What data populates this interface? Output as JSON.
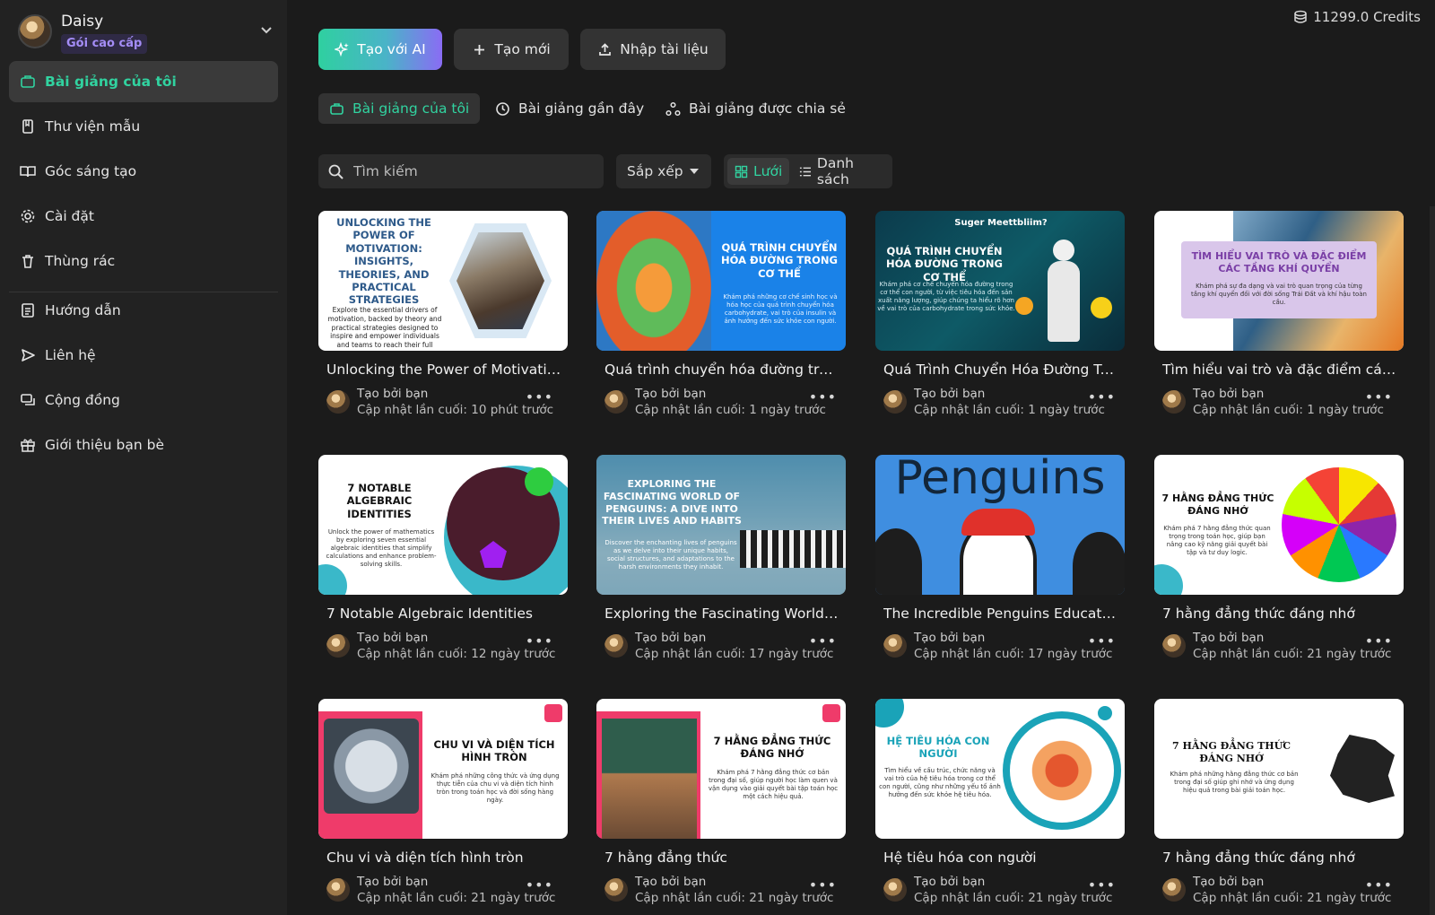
{
  "profile": {
    "name": "Daisy",
    "plan": "Gói cao cấp"
  },
  "credits": "11299.0 Credits",
  "sidebar": {
    "items": [
      {
        "label": "Bài giảng của tôi",
        "icon": "briefcase-icon"
      },
      {
        "label": "Thư viện mẫu",
        "icon": "book-icon"
      },
      {
        "label": "Góc sáng tạo",
        "icon": "open-book-icon"
      },
      {
        "label": "Cài đặt",
        "icon": "gear-icon"
      },
      {
        "label": "Thùng rác",
        "icon": "trash-icon"
      },
      {
        "label": "Hướng dẫn",
        "icon": "document-icon"
      },
      {
        "label": "Liên hệ",
        "icon": "send-icon"
      },
      {
        "label": "Cộng đồng",
        "icon": "community-icon"
      },
      {
        "label": "Giới thiệu bạn bè",
        "icon": "gift-icon"
      }
    ]
  },
  "actions": {
    "ai": "Tạo với AI",
    "new": "Tạo mới",
    "import": "Nhập tài liệu"
  },
  "tabs": [
    {
      "label": "Bài giảng của tôi"
    },
    {
      "label": "Bài giảng gần đây"
    },
    {
      "label": "Bài giảng được chia sẻ"
    }
  ],
  "search": {
    "placeholder": "Tìm kiếm"
  },
  "sort": {
    "label": "Sắp xếp"
  },
  "view": {
    "grid": "Lưới",
    "list": "Danh sách"
  },
  "cards": [
    {
      "title": "Unlocking the Power of Motivatio...",
      "creator": "Tạo bởi bạn",
      "updated": "Cập nhật lần cuối: 10 phút trước",
      "thumb": {
        "heading": "UNLOCKING THE POWER OF MOTIVATION: INSIGHTS, THEORIES, AND PRACTICAL STRATEGIES",
        "body": "Explore the essential drivers of motivation, backed by theory and practical strategies designed to inspire and empower individuals and teams to reach their full potential."
      }
    },
    {
      "title": "Quá trình chuyển hóa đường tron...",
      "creator": "Tạo bởi bạn",
      "updated": "Cập nhật lần cuối: 1 ngày trước",
      "thumb": {
        "heading": "QUÁ TRÌNH CHUYỂN HÓA ĐƯỜNG TRONG CƠ THỂ",
        "body": "Khám phá những cơ chế sinh học và hóa học của quá trình chuyển hóa carbohydrate, vai trò của insulin và ảnh hưởng đến sức khỏe con người."
      }
    },
    {
      "title": "Quá Trình Chuyển Hóa Đường Tro...",
      "creator": "Tạo bởi bạn",
      "updated": "Cập nhật lần cuối: 1 ngày trước",
      "thumb": {
        "top": "Suger Meettbliim?",
        "heading": "QUÁ TRÌNH CHUYỂN HÓA ĐƯỜNG TRONG CƠ THỂ",
        "body": "Khám phá cơ chế chuyển hóa đường trong cơ thể con người, từ việc tiêu hóa đến sản xuất năng lượng, giúp chúng ta hiểu rõ hơn về vai trò của carbohydrate trong sức khỏe."
      }
    },
    {
      "title": "Tìm hiểu vai trò và đặc điểm các t...",
      "creator": "Tạo bởi bạn",
      "updated": "Cập nhật lần cuối: 1 ngày trước",
      "thumb": {
        "heading": "TÌM HIỂU VAI TRÒ VÀ ĐẶC ĐIỂM CÁC TẦNG KHÍ QUYỂN",
        "body": "Khám phá sự đa dạng và vai trò quan trọng của từng tầng khí quyển đối với đời sống Trái Đất và khí hậu toàn cầu."
      }
    },
    {
      "title": "7 Notable Algebraic Identities",
      "creator": "Tạo bởi bạn",
      "updated": "Cập nhật lần cuối: 12 ngày trước",
      "thumb": {
        "heading": "7 NOTABLE ALGEBRAIC IDENTITIES",
        "body": "Unlock the power of mathematics by exploring seven essential algebraic identities that simplify calculations and enhance problem-solving skills."
      }
    },
    {
      "title": "Exploring the Fascinating World of...",
      "creator": "Tạo bởi bạn",
      "updated": "Cập nhật lần cuối: 17 ngày trước",
      "thumb": {
        "heading": "EXPLORING THE FASCINATING WORLD OF PENGUINS: A DIVE INTO THEIR LIVES AND HABITS",
        "body": "Discover the enchanting lives of penguins as we delve into their unique habits, social structures, and adaptations to the harsh environments they inhabit."
      }
    },
    {
      "title": "The Incredible Penguins Education...",
      "creator": "Tạo bởi bạn",
      "updated": "Cập nhật lần cuối: 17 ngày trước",
      "thumb": {
        "heading": "Penguins"
      }
    },
    {
      "title": "7 hằng đẳng thức đáng nhớ",
      "creator": "Tạo bởi bạn",
      "updated": "Cập nhật lần cuối: 21 ngày trước",
      "thumb": {
        "heading": "7 HẰNG ĐẲNG THỨC ĐÁNG NHỚ",
        "body": "Khám phá 7 hằng đẳng thức quan trọng trong toán học, giúp bạn nâng cao kỹ năng giải quyết bài tập và tư duy logic."
      }
    },
    {
      "title": "Chu vi và diện tích hình tròn",
      "creator": "Tạo bởi bạn",
      "updated": "Cập nhật lần cuối: 21 ngày trước",
      "thumb": {
        "heading": "CHU VI VÀ DIỆN TÍCH HÌNH TRÒN",
        "body": "Khám phá những công thức và ứng dụng thực tiễn của chu vi và diện tích hình tròn trong toán học và đời sống hàng ngày."
      }
    },
    {
      "title": "7 hằng đẳng thức",
      "creator": "Tạo bởi bạn",
      "updated": "Cập nhật lần cuối: 21 ngày trước",
      "thumb": {
        "heading": "7 HẰNG ĐẲNG THỨC ĐÁNG NHỚ",
        "body": "Khám phá 7 hằng đẳng thức cơ bản trong đại số, giúp người học làm quen và vận dụng vào giải quyết bài tập toán học một cách hiệu quả."
      }
    },
    {
      "title": "Hệ tiêu hóa con người",
      "creator": "Tạo bởi bạn",
      "updated": "Cập nhật lần cuối: 21 ngày trước",
      "thumb": {
        "heading": "HỆ TIÊU HÓA CON NGƯỜI",
        "body": "Tìm hiểu về cấu trúc, chức năng và vai trò của hệ tiêu hóa trong cơ thể con người, cũng như những yếu tố ảnh hưởng đến sức khỏe hệ tiêu hóa."
      }
    },
    {
      "title": "7 hằng đẳng thức đáng nhớ",
      "creator": "Tạo bởi bạn",
      "updated": "Cập nhật lần cuối: 21 ngày trước",
      "thumb": {
        "heading": "7 HẰNG ĐẲNG THỨC ĐÁNG NHỚ",
        "body": "Khám phá những hằng đẳng thức cơ bản trong đại số giúp ghi nhớ và ứng dụng hiệu quả trong bài giải toán học."
      }
    }
  ]
}
